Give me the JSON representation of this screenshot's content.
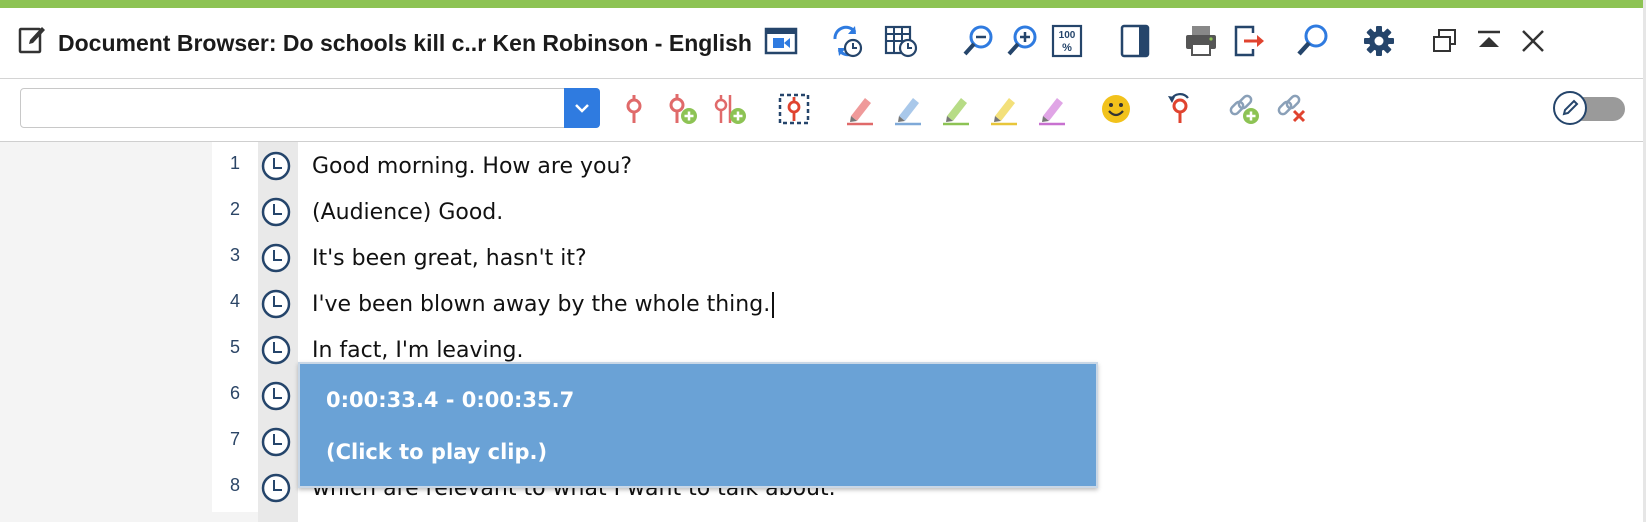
{
  "window": {
    "title": "Document Browser: Do schools kill c..r Ken Robinson - English"
  },
  "titlebar_icons": [
    "video-icon",
    "sync-icon",
    "table-time-icon",
    "zoom-out-icon",
    "zoom-in-icon",
    "zoom-100-icon",
    "panel-icon",
    "print-icon",
    "export-icon",
    "search-icon",
    "gear-icon",
    "detach-window-icon",
    "collapse-icon",
    "close-icon"
  ],
  "search": {
    "value": "",
    "placeholder": ""
  },
  "toolbar_icons": [
    "code-icon",
    "code-add-icon",
    "code-multiple-add-icon",
    "select-region-icon",
    "highlight-red-icon",
    "highlight-blue-icon",
    "highlight-green-icon",
    "highlight-yellow-icon",
    "highlight-purple-icon",
    "emoticon-icon",
    "undo-code-icon",
    "link-add-icon",
    "link-remove-icon"
  ],
  "edit_toggle": {
    "state": "off"
  },
  "colors": {
    "accent_bar": "#8dc354",
    "primary_blue": "#2f7be0",
    "icon_navy": "#25456b",
    "tooltip_bg": "#6aa2d6"
  },
  "transcript": [
    {
      "num": "1",
      "text": "Good morning. How are you?"
    },
    {
      "num": "2",
      "text": "(Audience) Good."
    },
    {
      "num": "3",
      "text": "It's been great, hasn't it?"
    },
    {
      "num": "4",
      "text": "I've been blown away by the whole thing."
    },
    {
      "num": "5",
      "text": "In fact, I'm leaving."
    },
    {
      "num": "6",
      "text": ""
    },
    {
      "num": "7",
      "text": ""
    },
    {
      "num": "8",
      "text": "which are relevant to what I want to talk about."
    }
  ],
  "tooltip": {
    "time_range": "0:00:33.4 - 0:00:35.7",
    "hint": "(Click to play clip.)"
  }
}
